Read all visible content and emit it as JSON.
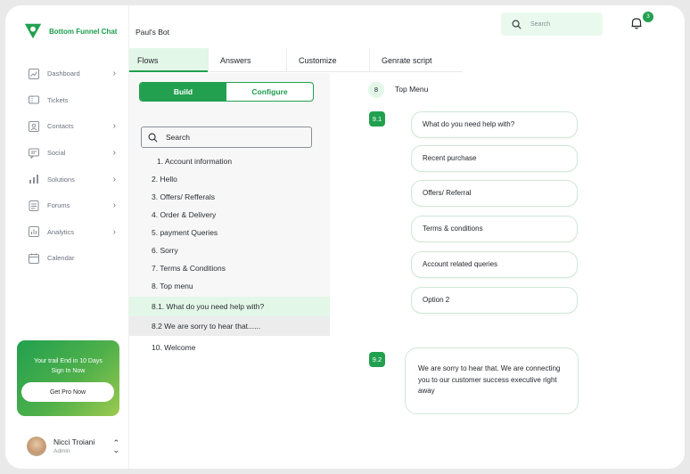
{
  "brand": {
    "name": "Bottom Funnel Chat",
    "color": "#1a9d4c"
  },
  "header": {
    "bot_title": "Paul's Bot",
    "search_placeholder": "Search",
    "notifications_count": "3"
  },
  "sidebar": {
    "items": [
      {
        "label": "Dashboard",
        "icon": "chart-icon",
        "has_chevron": true
      },
      {
        "label": "Tickets",
        "icon": "ticket-icon",
        "has_chevron": false
      },
      {
        "label": "Contacts",
        "icon": "contacts-icon",
        "has_chevron": true
      },
      {
        "label": "Social",
        "icon": "social-icon",
        "has_chevron": true
      },
      {
        "label": "Solutions",
        "icon": "solutions-icon",
        "has_chevron": true
      },
      {
        "label": "Forums",
        "icon": "forums-icon",
        "has_chevron": true
      },
      {
        "label": "Analytics",
        "icon": "analytics-icon",
        "has_chevron": true
      },
      {
        "label": "Calendar",
        "icon": "calendar-icon",
        "has_chevron": false
      }
    ],
    "promo": {
      "line1": "Your trail End in 10 Days",
      "line2": "Sign In Now",
      "button": "Get Pro Now"
    },
    "user": {
      "name": "Nicci Troiani",
      "role": "Admin"
    }
  },
  "tabs": [
    "Flows",
    "Answers",
    "Customize",
    "Genrate script"
  ],
  "builder": {
    "segments": [
      "Build",
      "Configure"
    ],
    "search_label": "Search",
    "flows": [
      "1. Account information",
      "2. Hello",
      "3. Offers/ Refferals",
      "4. Order & Delivery",
      "5. payment Queries",
      "6. Sorry",
      "7. Terms & Conditions",
      "8. Top menu",
      "8.1.  What do you need help with?",
      "8.2  We are sorry to hear that......",
      "10. Welcome"
    ]
  },
  "canvas": {
    "node_main": {
      "number": "8",
      "title": "Top Menu"
    },
    "node_91": "9.1",
    "node_92": "9.2",
    "options": [
      "What do you need help with?",
      "Recent purchase",
      "Offers/ Referral",
      "Terms & conditions",
      "Account related queries",
      "Option 2"
    ],
    "message": "We are sorry to hear that. We are connecting you to our customer success executive right away"
  },
  "colors": {
    "accent": "#22a04f",
    "accent_light": "#e3f7e8",
    "panel_bg": "#f7f7f7"
  }
}
